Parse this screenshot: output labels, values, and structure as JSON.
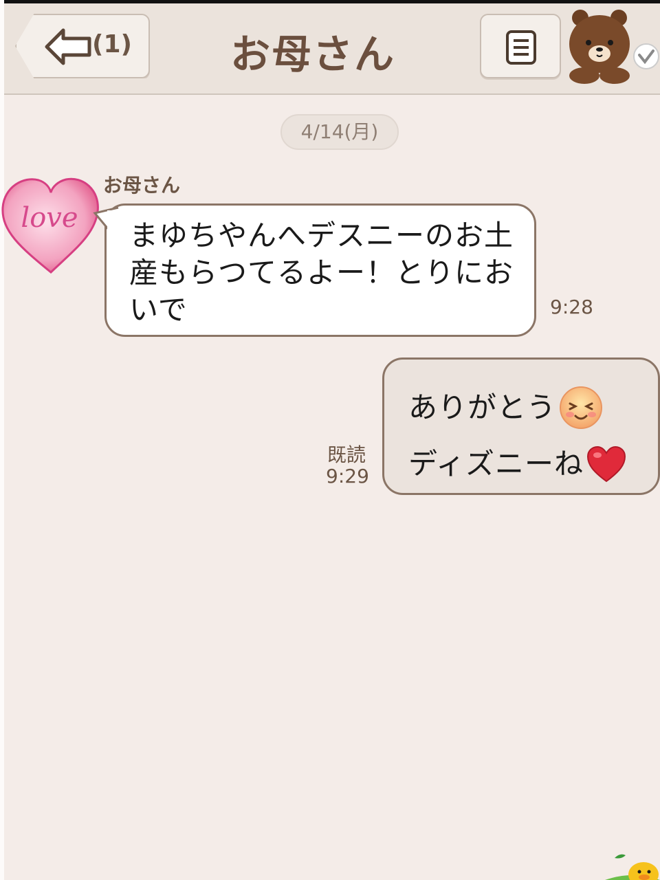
{
  "header": {
    "back_count": "(1)",
    "title": "お母さん"
  },
  "chat": {
    "date": "4/14(月)",
    "messages": [
      {
        "direction": "incoming",
        "sender": "お母さん",
        "text": "まゆちやんへデスニーのお土産もらつてるよー！とりにおいで",
        "time": "9:28"
      },
      {
        "direction": "outgoing",
        "line1": "ありがとう",
        "line2": "ディズニーね",
        "read_label": "既読",
        "time": "9:29"
      }
    ]
  },
  "avatar": {
    "label": "love"
  },
  "colors": {
    "background": "#f4ece8",
    "header": "#ebe3dc",
    "bubble_border": "#8b7566",
    "text_brown": "#6b5545"
  }
}
